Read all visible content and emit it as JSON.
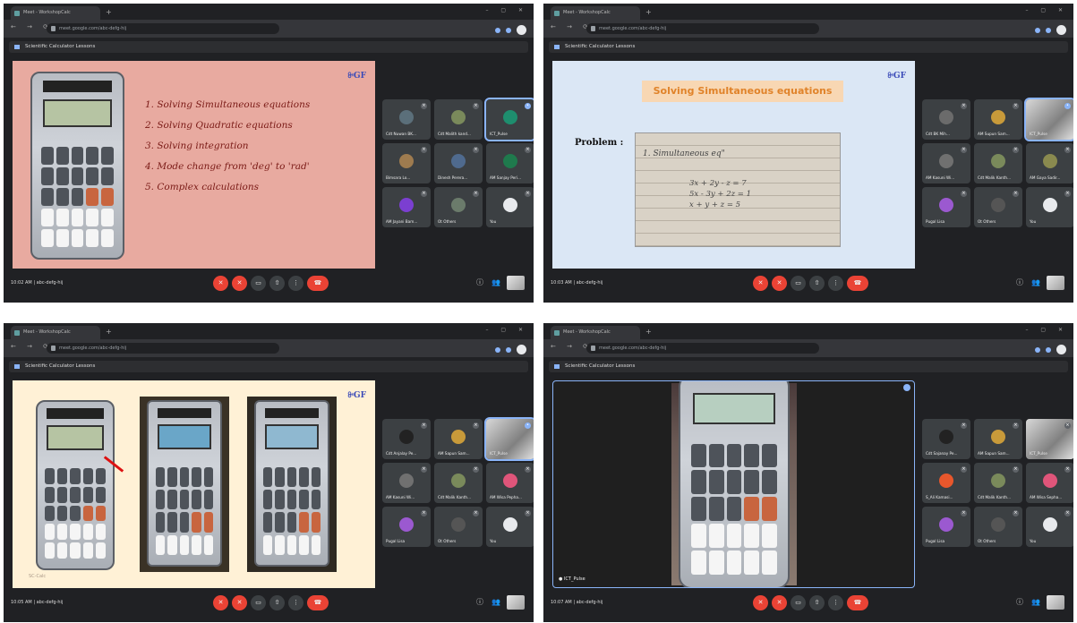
{
  "panels": [
    {
      "tab_title": "Meet - WorkshopCalc",
      "url": "meet.google.com/abc-defg-hij",
      "meeting_name": "Scientific Calculator Lessons",
      "time": "10:02 AM",
      "code": "abc-defg-hij"
    },
    {
      "tab_title": "Meet - WorkshopCalc",
      "url": "meet.google.com/abc-defg-hij",
      "meeting_name": "Scientific Calculator Lessons",
      "time": "10:03 AM",
      "code": "abc-defg-hij"
    },
    {
      "tab_title": "Meet - WorkshopCalc",
      "url": "meet.google.com/abc-defg-hij",
      "meeting_name": "Scientific Calculator Lessons",
      "time": "10:05 AM",
      "code": "abc-defg-hij"
    },
    {
      "tab_title": "Meet - WorkshopCalc",
      "url": "meet.google.com/abc-defg-hij",
      "meeting_name": "Scientific Calculator Lessons",
      "time": "10:07 AM",
      "code": "abc-defg-hij"
    }
  ],
  "slide1": {
    "items": [
      "1. Solving Simultaneous equations",
      "2. Solving Quadratic equations",
      "3. Solving integration",
      "4. Mode change from 'deg' to 'rad'",
      "5. Complex calculations"
    ]
  },
  "slide2": {
    "title": "Solving Simultaneous equations",
    "problem_label": "Problem :",
    "note_lines": [
      "1. Simultaneous eq\"",
      "3x + 2y - z = 7",
      "5x - 3y + 2z = 1",
      "x + y + z = 5"
    ]
  },
  "slide3": {
    "footnote": "SC-Calc"
  },
  "panel4": {
    "presenter": "ICT_Pulse"
  },
  "logo": "ꔬGF",
  "participants1": [
    "Cdt Nuwan BK...",
    "Cdt Malith kand...",
    "ICT_Pulse",
    "Bimsara Lo...",
    "Dinesh Perera...",
    "AM Sanjay Peri...",
    "AM Jayani Bam...",
    "Ot Others",
    "You"
  ],
  "participants2": [
    "Cdt BK Mih...",
    "AM Supun Sam...",
    "ICT_Pulse",
    "AM Kasuni Wi...",
    "Cdt Malik Kanth...",
    "AM Gaya Sadir...",
    "Pugal Lisa",
    "Ot Others",
    "You"
  ],
  "participants3": [
    "Cdt Anjalay Pe...",
    "AM Sapun Sam...",
    "ICT_Pulse",
    "AM Kasuni Wi...",
    "Cdt Malik Kanth...",
    "AM Wisa Pepha...",
    "Pugal Lisa",
    "Ot Others",
    "You"
  ],
  "participants4": [
    "Cdt Sajanay Pe...",
    "AM Sapun Sam...",
    "ICT_Pulse",
    "S_Ali Kamasi...",
    "Cdt Malik Kanth...",
    "AM Wisa Sepha...",
    "Pugal Lisa",
    "Ot Others",
    "You"
  ],
  "colors": {
    "meet_bg": "#202124",
    "tile": "#3c4043",
    "end_call": "#ea4335",
    "slide1_bg": "#e8aaa0",
    "slide2_bg": "#dbe7f5",
    "slide3_bg": "#fff1d6",
    "accent": "#8ab4f8"
  }
}
